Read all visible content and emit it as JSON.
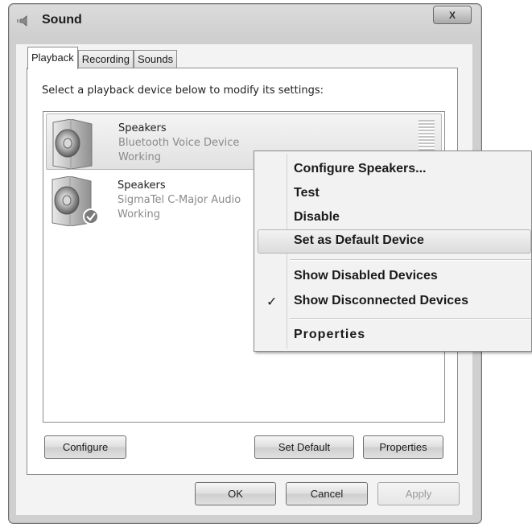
{
  "window": {
    "title": "Sound",
    "close_label": "X"
  },
  "tabs": [
    {
      "label": "Playback"
    },
    {
      "label": "Recording"
    },
    {
      "label": "Sounds"
    }
  ],
  "panel": {
    "prompt": "Select a playback device below to modify its settings:"
  },
  "devices": [
    {
      "name": "Speakers",
      "description": "Bluetooth Voice Device",
      "status": "Working"
    },
    {
      "name": "Speakers",
      "description": "SigmaTel C-Major Audio",
      "status": "Working"
    }
  ],
  "buttons": {
    "configure": "Configure",
    "set_default": "Set Default",
    "properties": "Properties",
    "ok": "OK",
    "cancel": "Cancel",
    "apply": "Apply"
  },
  "context_menu": {
    "items": [
      {
        "label": "Configure Speakers..."
      },
      {
        "label": "Test"
      },
      {
        "label": "Disable"
      },
      {
        "label": "Set as Default Device"
      },
      {
        "label": "Show Disabled Devices"
      },
      {
        "label": "Show Disconnected Devices",
        "check": "✓"
      },
      {
        "label": "Properties"
      }
    ]
  }
}
